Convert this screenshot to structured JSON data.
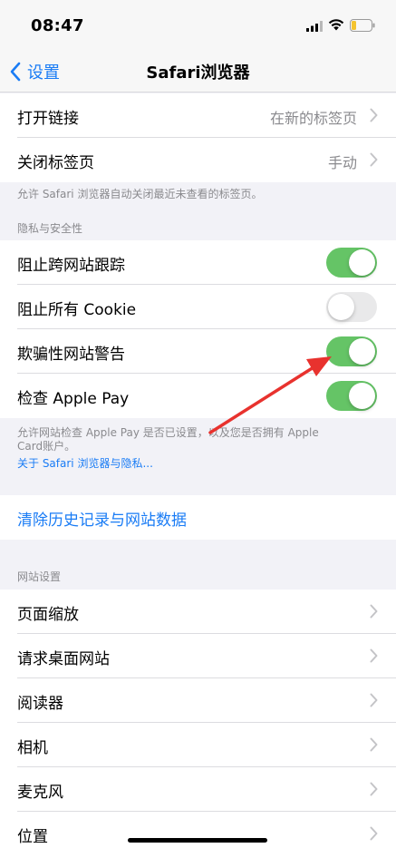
{
  "status_bar": {
    "time": "08:47"
  },
  "nav": {
    "back_label": "设置",
    "title": "Safari浏览器"
  },
  "tabs_section": {
    "items": [
      {
        "label": "打开链接",
        "value": "在新的标签页"
      },
      {
        "label": "关闭标签页",
        "value": "手动"
      }
    ],
    "footnote": "允许 Safari 浏览器自动关闭最近未查看的标签页。"
  },
  "privacy_section": {
    "header": "隐私与安全性",
    "items": [
      {
        "label": "阻止跨网站跟踪",
        "enabled": true
      },
      {
        "label": "阻止所有 Cookie",
        "enabled": false
      },
      {
        "label": "欺骗性网站警告",
        "enabled": true
      },
      {
        "label": "检查 Apple Pay",
        "enabled": true
      }
    ],
    "footnote_line1": "允许网站检查 Apple Pay 是否已设置，以及您是否拥有 Apple",
    "footnote_line2": "Card账户。",
    "link": "关于 Safari 浏览器与隐私..."
  },
  "clear_action": {
    "label": "清除历史记录与网站数据"
  },
  "website_section": {
    "header": "网站设置",
    "items": [
      {
        "label": "页面缩放"
      },
      {
        "label": "请求桌面网站"
      },
      {
        "label": "阅读器"
      },
      {
        "label": "相机"
      },
      {
        "label": "麦克风"
      },
      {
        "label": "位置"
      }
    ]
  },
  "colors": {
    "accent": "#1a7cf5",
    "toggle_on": "#65c466",
    "toggle_off": "#e9e9ea",
    "annotation_arrow": "#e8322e"
  }
}
